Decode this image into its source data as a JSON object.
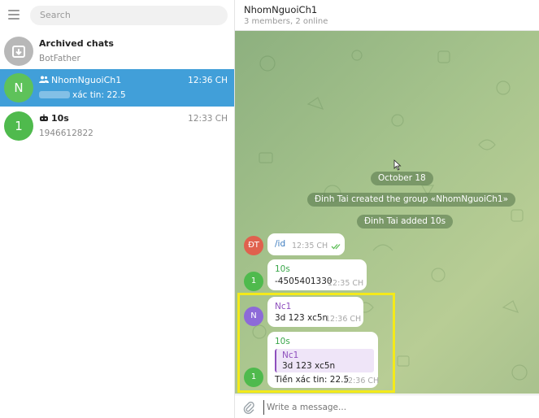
{
  "sidebar": {
    "search_placeholder": "Search",
    "chats": [
      {
        "title": "Archived chats",
        "subtitle": "BotFather",
        "time": "",
        "avatar_letter": "",
        "avatar_color": "#b8b8b8"
      },
      {
        "title": "NhomNguoiCh1",
        "subtitle": "xác tin: 22.5",
        "time": "12:36 CH",
        "avatar_letter": "N",
        "avatar_color": "#5ec25a",
        "active": true
      },
      {
        "title": "10s",
        "subtitle": "1946612822",
        "time": "12:33 CH",
        "avatar_letter": "1",
        "avatar_color": "#4fba4d"
      }
    ]
  },
  "header": {
    "title": "NhomNguoiCh1",
    "subtitle": "3 members, 2 online"
  },
  "messages": {
    "date": "October 18",
    "service1": "Đinh Tai created the group «NhomNguoiCh1»",
    "service2": "Đinh Tai added 10s",
    "m1": {
      "avatar": "ĐT",
      "avatar_color": "#e0614e",
      "text": "/id",
      "time": "12:35 CH",
      "status": "read"
    },
    "m2": {
      "avatar": "1",
      "avatar_color": "#4fba4d",
      "sender": "10s",
      "sender_color": "#3aa64a",
      "text": "-4505401330",
      "time": "12:35 CH"
    },
    "m3": {
      "avatar": "N",
      "avatar_color": "#8d6ad8",
      "sender": "Nc1",
      "sender_color": "#8e4fbd",
      "text": "3d 123 xc5n",
      "time": "12:36 CH"
    },
    "m4": {
      "avatar": "1",
      "avatar_color": "#4fba4d",
      "sender": "10s",
      "sender_color": "#3aa64a",
      "reply_sender": "Nc1",
      "reply_text": "3d 123 xc5n",
      "text": "Tiền xác tin: 22.5",
      "time": "12:36 CH"
    }
  },
  "compose": {
    "placeholder": "Write a message..."
  }
}
